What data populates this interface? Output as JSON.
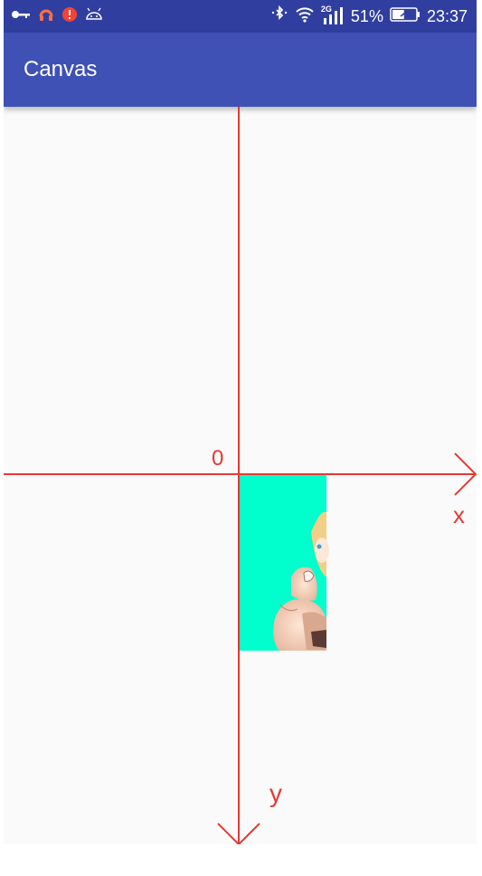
{
  "status_bar": {
    "left_icons": [
      "key-icon",
      "headset-icon",
      "notification-badge-icon",
      "android-icon"
    ],
    "right_icons": [
      "bluetooth-icon",
      "wifi-icon",
      "signal-icon"
    ],
    "network_type": "2G",
    "battery_percent": "51%",
    "battery_level": 0.51,
    "time": "23:37"
  },
  "app_bar": {
    "title": "Canvas"
  },
  "canvas": {
    "axis_color": "#e53935",
    "origin_label": "0",
    "x_label": "x",
    "y_label": "y",
    "image": {
      "description_name": "anime-girl-image",
      "background_color": "#00ffcc"
    }
  }
}
